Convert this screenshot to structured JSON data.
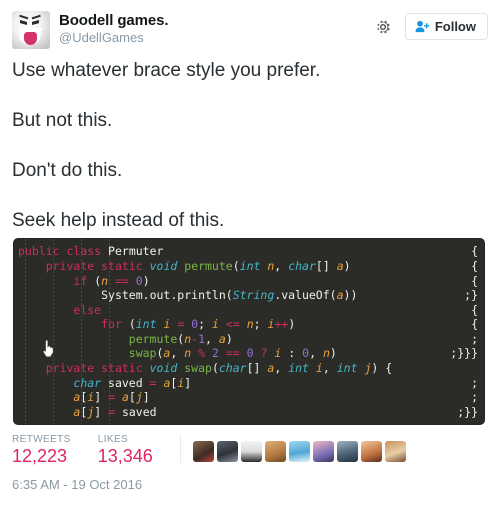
{
  "account": {
    "display_name": "Boodell games.",
    "handle": "@UdellGames",
    "avatar_icon": "boo-ghost-avatar"
  },
  "header": {
    "gear_icon": "gear-icon",
    "follow_label": "Follow",
    "follow_icon": "person-add-icon"
  },
  "tweet": {
    "lines": [
      "Use whatever brace style you prefer.",
      "But not this.",
      "Don't do this.",
      "Seek help instead of this."
    ]
  },
  "code": {
    "language": "java",
    "background": "#2b2b28",
    "colors": {
      "keyword": "#cc2f5b",
      "type": "#45b5c6",
      "method": "#7bb547",
      "param": "#e8a33d",
      "number": "#9a6fd4",
      "plain": "#f2f2ea"
    },
    "lines": [
      {
        "source": "public class Permuter",
        "tail": "{"
      },
      {
        "source": "    private static void permute(int n, char[] a)",
        "tail": "{"
      },
      {
        "source": "        if (n == 0)",
        "tail": "{"
      },
      {
        "source": "            System.out.println(String.valueOf(a))",
        "tail": ";}"
      },
      {
        "source": "        else",
        "tail": "{"
      },
      {
        "source": "            for (int i = 0; i <= n; i++)",
        "tail": "{"
      },
      {
        "source": "                permute(n-1, a)",
        "tail": ";"
      },
      {
        "source": "                swap(a, n % 2 == 0 ? i : 0, n)",
        "tail": ";}}}"
      },
      {
        "source": "    private static void swap(char[] a, int i, int j) {",
        "tail": ""
      },
      {
        "source": "        char saved = a[i]",
        "tail": ";"
      },
      {
        "source": "        a[i] = a[j]",
        "tail": ";"
      },
      {
        "source": "        a[j] = saved",
        "tail": ";}}"
      }
    ]
  },
  "cursor": {
    "icon": "pointing-hand-cursor"
  },
  "stats": {
    "retweets_label": "RETWEETS",
    "retweets_value": "12,223",
    "likes_label": "LIKES",
    "likes_value": "13,346",
    "liker_count": 9
  },
  "footer": {
    "timestamp": "6:35 AM - 19 Oct 2016"
  }
}
